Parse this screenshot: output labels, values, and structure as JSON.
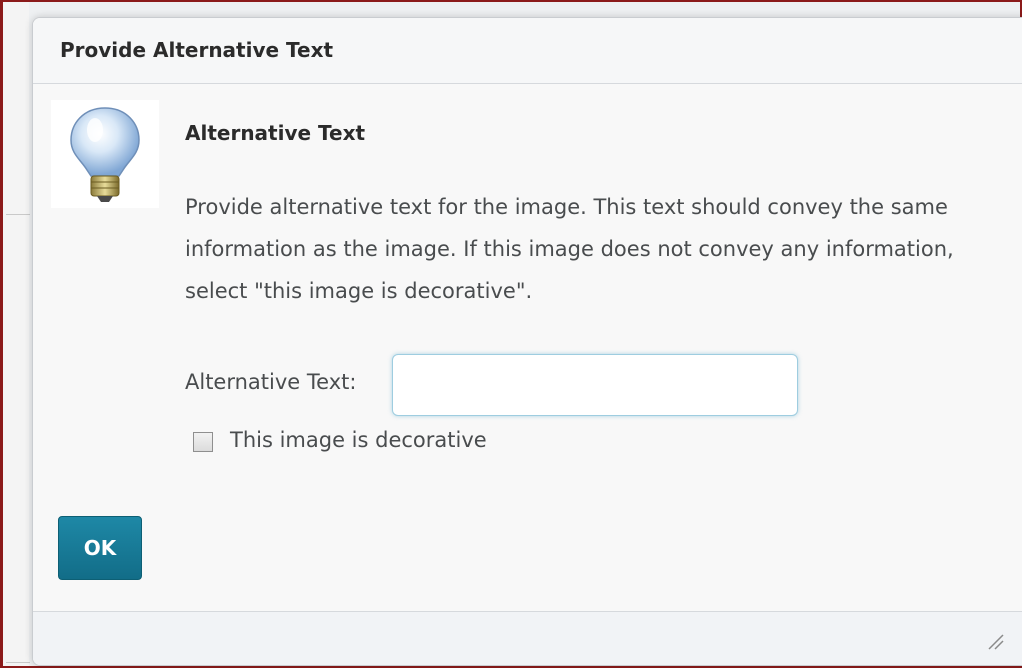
{
  "dialog": {
    "title": "Provide Alternative Text",
    "section_heading": "Alternative Text",
    "description": "Provide alternative text for the image. This text should convey the same information as the image. If this image does not convey any information, select \"this image is decorative\".",
    "alt_text_label": "Alternative Text:",
    "alt_text_value": "",
    "decorative_label": "This image is decorative",
    "decorative_checked": false,
    "ok_label": "OK",
    "icon": "lightbulb-icon",
    "resize_icon": "resize-grip-icon"
  },
  "colors": {
    "ok_button": "#1a7f9c",
    "frame": "#8b1a1a"
  }
}
